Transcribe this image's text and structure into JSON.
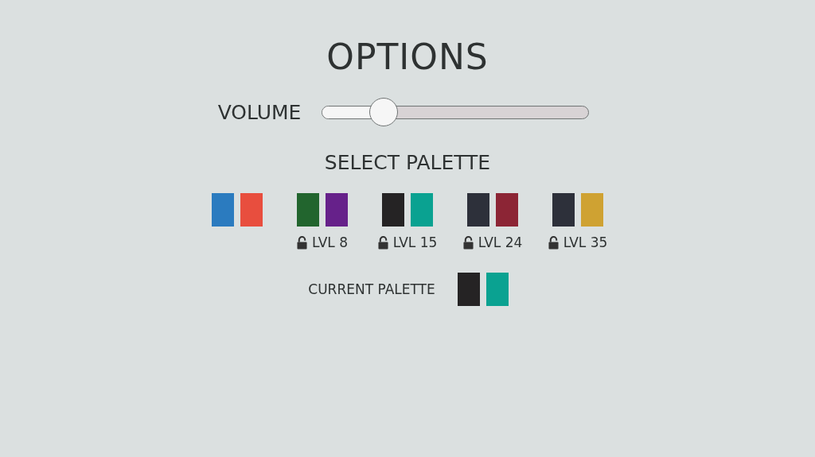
{
  "title": "OPTIONS",
  "volume": {
    "label": "VOLUME",
    "level": 0.23
  },
  "palette_heading": "SELECT PALETTE",
  "palettes": [
    {
      "swatches": [
        {
          "color": "#2b7bbf"
        },
        {
          "color": "#e84e3e"
        }
      ]
    },
    {
      "swatches": [
        {
          "color": "#22652e"
        },
        {
          "color": "#66218a"
        }
      ],
      "unlock": "LVL 8"
    },
    {
      "swatches": [
        {
          "color": "#252324"
        },
        {
          "color": "#0aa291"
        }
      ],
      "unlock": "LVL 15"
    },
    {
      "swatches": [
        {
          "color": "#2d303a"
        },
        {
          "color": "#8c2535"
        }
      ],
      "unlock": "LVL 24"
    },
    {
      "swatches": [
        {
          "color": "#2d303a"
        },
        {
          "color": "#cfa232"
        }
      ],
      "unlock": "LVL 35"
    }
  ],
  "current": {
    "label": "CURRENT PALETTE",
    "swatches": [
      {
        "color": "#252324"
      },
      {
        "color": "#0aa291"
      }
    ]
  }
}
